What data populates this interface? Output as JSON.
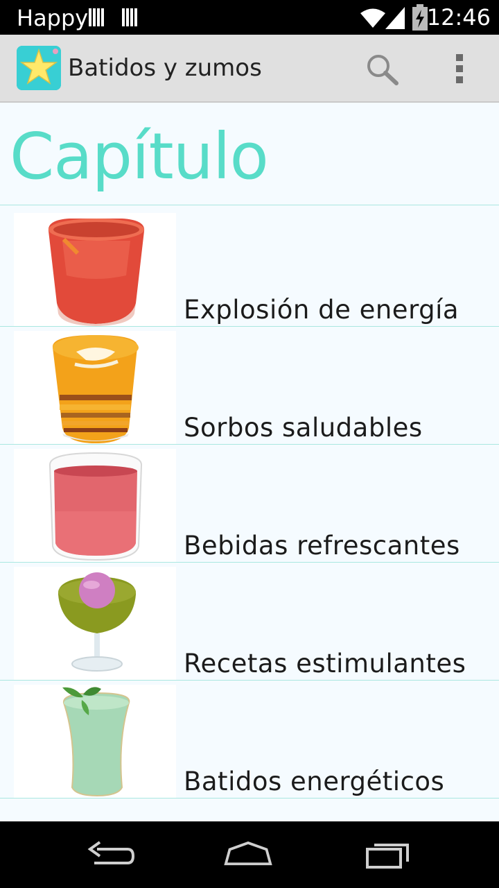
{
  "status_bar": {
    "carrier": "Happy",
    "time": "12:46"
  },
  "action_bar": {
    "title": "Batidos y zumos",
    "icons": [
      "star-app-icon",
      "search-icon",
      "overflow-menu-icon"
    ]
  },
  "main": {
    "heading": "Capítulo",
    "chapters": [
      {
        "label": "Explosión de energía",
        "thumb": "red-smoothie-glass"
      },
      {
        "label": "Sorbos saludables",
        "thumb": "layered-orange-drink"
      },
      {
        "label": "Bebidas refrescantes",
        "thumb": "pink-smoothie-glass"
      },
      {
        "label": "Recetas estimulantes",
        "thumb": "kiwi-drink-with-ice-cream"
      },
      {
        "label": "Batidos energéticos",
        "thumb": "green-milkshake-with-mint"
      }
    ]
  },
  "nav_bar": {
    "icons": [
      "back-icon",
      "home-icon",
      "recent-apps-icon"
    ]
  },
  "colors": {
    "accent": "#58dcc8",
    "divider": "#a9e7e0",
    "background": "#f5fbff",
    "action_bar": "#e0e0e0"
  }
}
